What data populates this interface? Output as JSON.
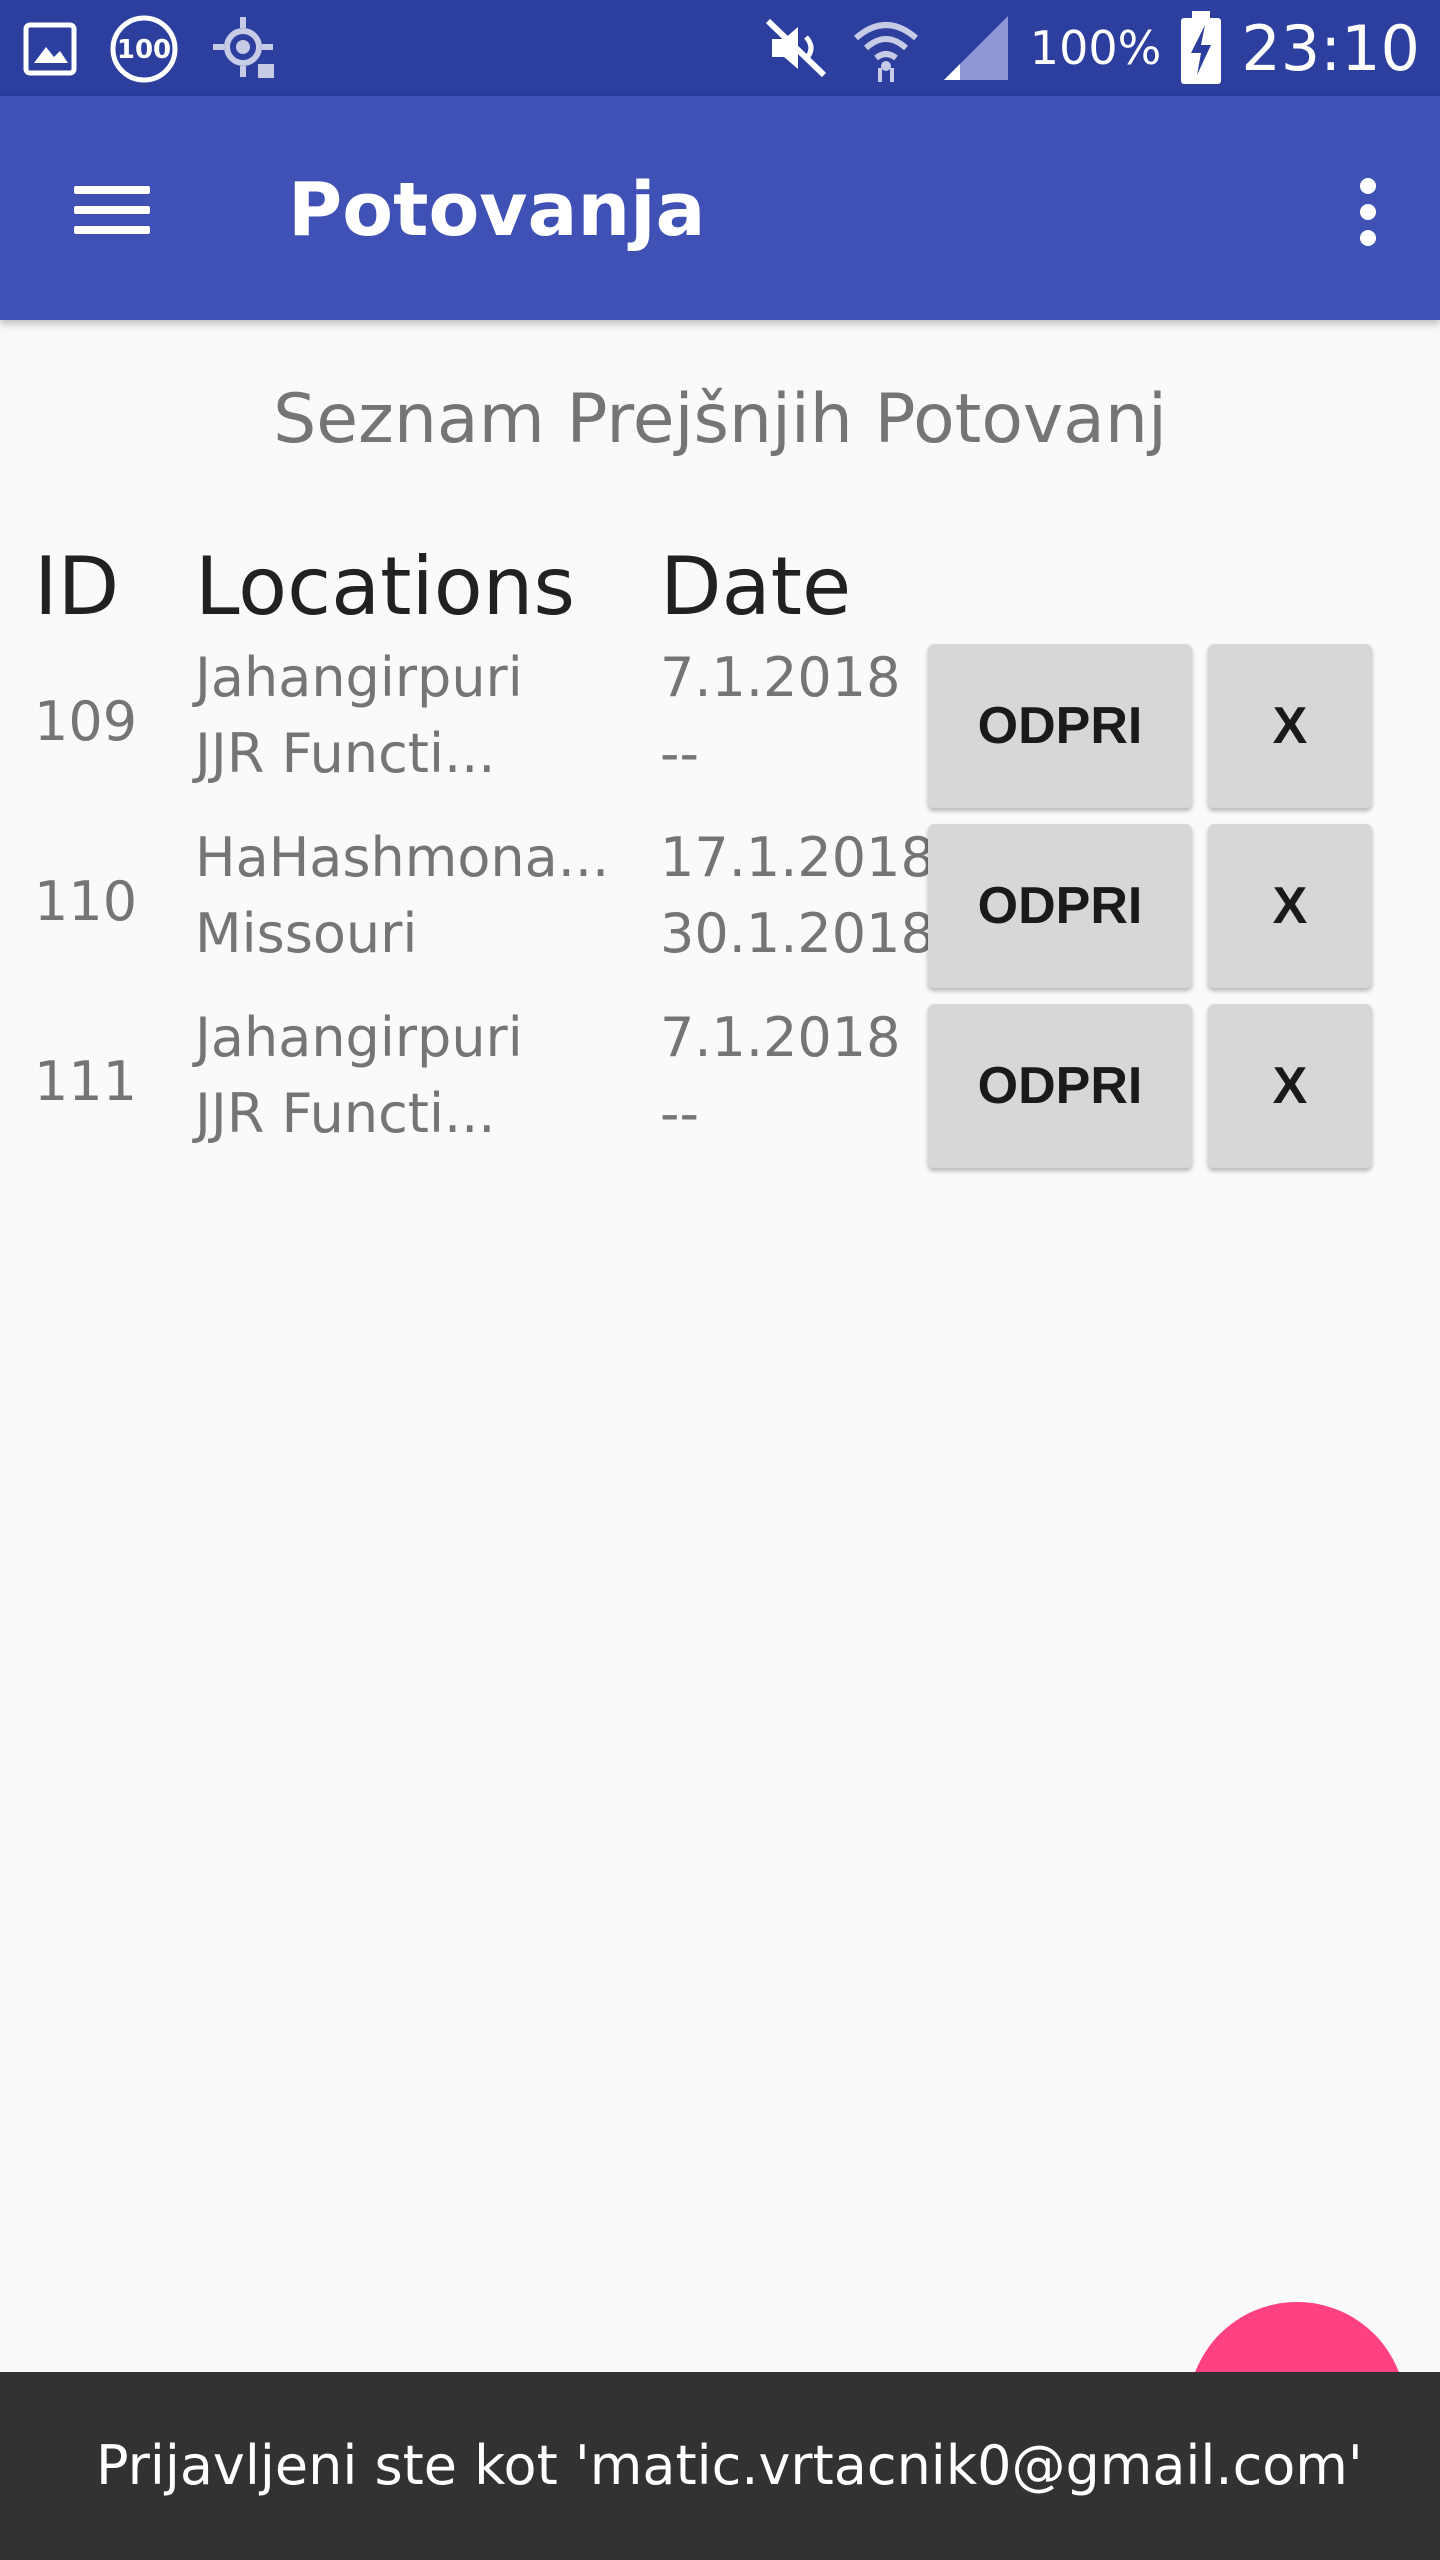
{
  "status_bar": {
    "icons_left": [
      "image-icon",
      "badge-100-icon",
      "location-icon"
    ],
    "badge_text": "100",
    "icons_right": [
      "mute-icon",
      "wifi-icon",
      "signal-icon",
      "battery-charging-icon"
    ],
    "battery": "100%",
    "time": "23:10"
  },
  "app_bar": {
    "title": "Potovanja",
    "menu_icon": "hamburger-menu-icon",
    "overflow_icon": "more-vert-icon",
    "color": "#3f51b5"
  },
  "main": {
    "subtitle": "Seznam Prejšnjih Potovanj",
    "columns": [
      "ID",
      "Locations",
      "Date"
    ],
    "rows": [
      {
        "id": "109",
        "loc1": "Jahangirpuri",
        "loc2": "JJR Functi...",
        "date1": "7.1.2018",
        "date2": "--",
        "open": "ODPRI",
        "delete": "X"
      },
      {
        "id": "110",
        "loc1": "HaHashmona...",
        "loc2": "Missouri",
        "date1": "17.1.2018",
        "date2": "30.1.2018",
        "open": "ODPRI",
        "delete": "X"
      },
      {
        "id": "111",
        "loc1": "Jahangirpuri",
        "loc2": "JJR Functi...",
        "date1": "7.1.2018",
        "date2": "--",
        "open": "ODPRI",
        "delete": "X"
      }
    ]
  },
  "fab": {
    "color": "#ff4081"
  },
  "snackbar": {
    "text": "Prijavljeni ste kot 'matic.vrtacnik0@gmail.com'"
  }
}
